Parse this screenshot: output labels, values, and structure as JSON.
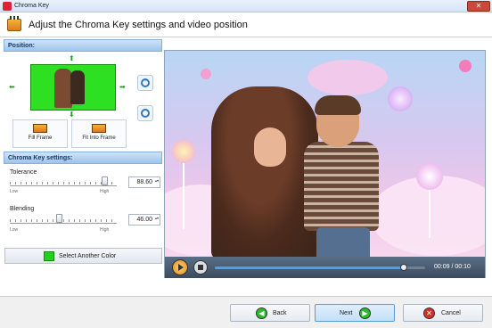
{
  "window": {
    "title": "Chroma Key",
    "close_glyph": "✕"
  },
  "header": {
    "title": "Adjust the Chroma Key settings and video position",
    "icon": "clapperboard-icon"
  },
  "position": {
    "heading": "Position:",
    "arrows": {
      "up": "⬆",
      "down": "⬇",
      "left": "⬅",
      "right": "➡"
    },
    "zoom_in_glyph": "+",
    "zoom_out_glyph": "−",
    "fill_frame_label": "Fill Frame",
    "fit_into_frame_label": "Fit Into Frame"
  },
  "chroma_key": {
    "heading": "Chroma Key settings:",
    "tolerance": {
      "label": "Tolerance",
      "value": "88.60",
      "level": 0.886,
      "low": "Low",
      "high": "High"
    },
    "blending": {
      "label": "Blending",
      "value": "46.00",
      "level": 0.46,
      "low": "Low",
      "high": "High"
    },
    "select_color_label": "Select Another Color",
    "key_color": "#1ed41a"
  },
  "player": {
    "time": "00:09 / 00:10",
    "progress": 0.9
  },
  "footer": {
    "back_label": "Back",
    "next_label": "Next",
    "cancel_label": "Cancel"
  }
}
